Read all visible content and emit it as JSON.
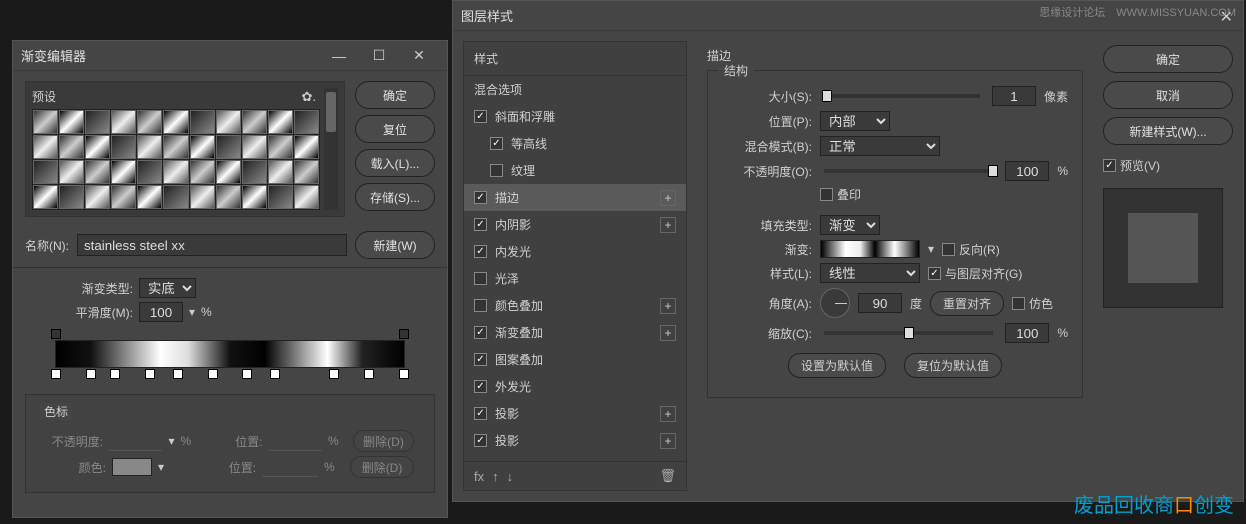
{
  "watermark": {
    "top": "思缘设计论坛　WWW.MISSYUAN.COM",
    "bottom_a": "废品回收商",
    "bottom_b": "创变"
  },
  "gradEditor": {
    "title": "渐变编辑器",
    "presets": "预设",
    "buttons": {
      "ok": "确定",
      "reset": "复位",
      "load": "载入(L)...",
      "save": "存储(S)...",
      "new": "新建(W)"
    },
    "name_label": "名称(N):",
    "name_value": "stainless steel xx",
    "type_label": "渐变类型:",
    "type_value": "实底",
    "smooth_label": "平滑度(M):",
    "smooth_value": "100",
    "smooth_unit": "%",
    "stops_header": "色标",
    "opacity_label": "不透明度:",
    "position_label": "位置:",
    "color_label": "颜色:",
    "delete_label": "删除(D)",
    "pct": "%"
  },
  "layerStyle": {
    "title": "图层样式",
    "left": {
      "header": "样式",
      "blend": "混合选项",
      "items": [
        {
          "label": "斜面和浮雕",
          "checked": true,
          "sub": false,
          "plus": false
        },
        {
          "label": "等高线",
          "checked": true,
          "sub": true,
          "plus": false
        },
        {
          "label": "纹理",
          "checked": false,
          "sub": true,
          "plus": false
        },
        {
          "label": "描边",
          "checked": true,
          "sub": false,
          "plus": true,
          "selected": true
        },
        {
          "label": "内阴影",
          "checked": true,
          "sub": false,
          "plus": true
        },
        {
          "label": "内发光",
          "checked": true,
          "sub": false,
          "plus": false
        },
        {
          "label": "光泽",
          "checked": false,
          "sub": false,
          "plus": false
        },
        {
          "label": "颜色叠加",
          "checked": false,
          "sub": false,
          "plus": true
        },
        {
          "label": "渐变叠加",
          "checked": true,
          "sub": false,
          "plus": true
        },
        {
          "label": "图案叠加",
          "checked": true,
          "sub": false,
          "plus": false
        },
        {
          "label": "外发光",
          "checked": true,
          "sub": false,
          "plus": false
        },
        {
          "label": "投影",
          "checked": true,
          "sub": false,
          "plus": true
        },
        {
          "label": "投影",
          "checked": true,
          "sub": false,
          "plus": true
        }
      ],
      "fx": "fx"
    },
    "mid": {
      "panel_title": "描边",
      "structure": "结构",
      "size_label": "大小(S):",
      "size_value": "1",
      "size_unit": "像素",
      "position_label": "位置(P):",
      "position_value": "内部",
      "blend_label": "混合模式(B):",
      "blend_value": "正常",
      "opacity_label": "不透明度(O):",
      "opacity_value": "100",
      "opacity_unit": "%",
      "overprint": "叠印",
      "fill_type_label": "填充类型:",
      "fill_type_value": "渐变",
      "gradient_label": "渐变:",
      "reverse": "反向(R)",
      "style_label": "样式(L):",
      "style_value": "线性",
      "align_layer": "与图层对齐(G)",
      "angle_label": "角度(A):",
      "angle_value": "90",
      "angle_unit": "度",
      "reset_align": "重置对齐",
      "dither": "仿色",
      "scale_label": "缩放(C):",
      "scale_value": "100",
      "scale_unit": "%",
      "set_default": "设置为默认值",
      "reset_default": "复位为默认值"
    },
    "right": {
      "ok": "确定",
      "cancel": "取消",
      "new_style": "新建样式(W)...",
      "preview": "预览(V)"
    }
  }
}
